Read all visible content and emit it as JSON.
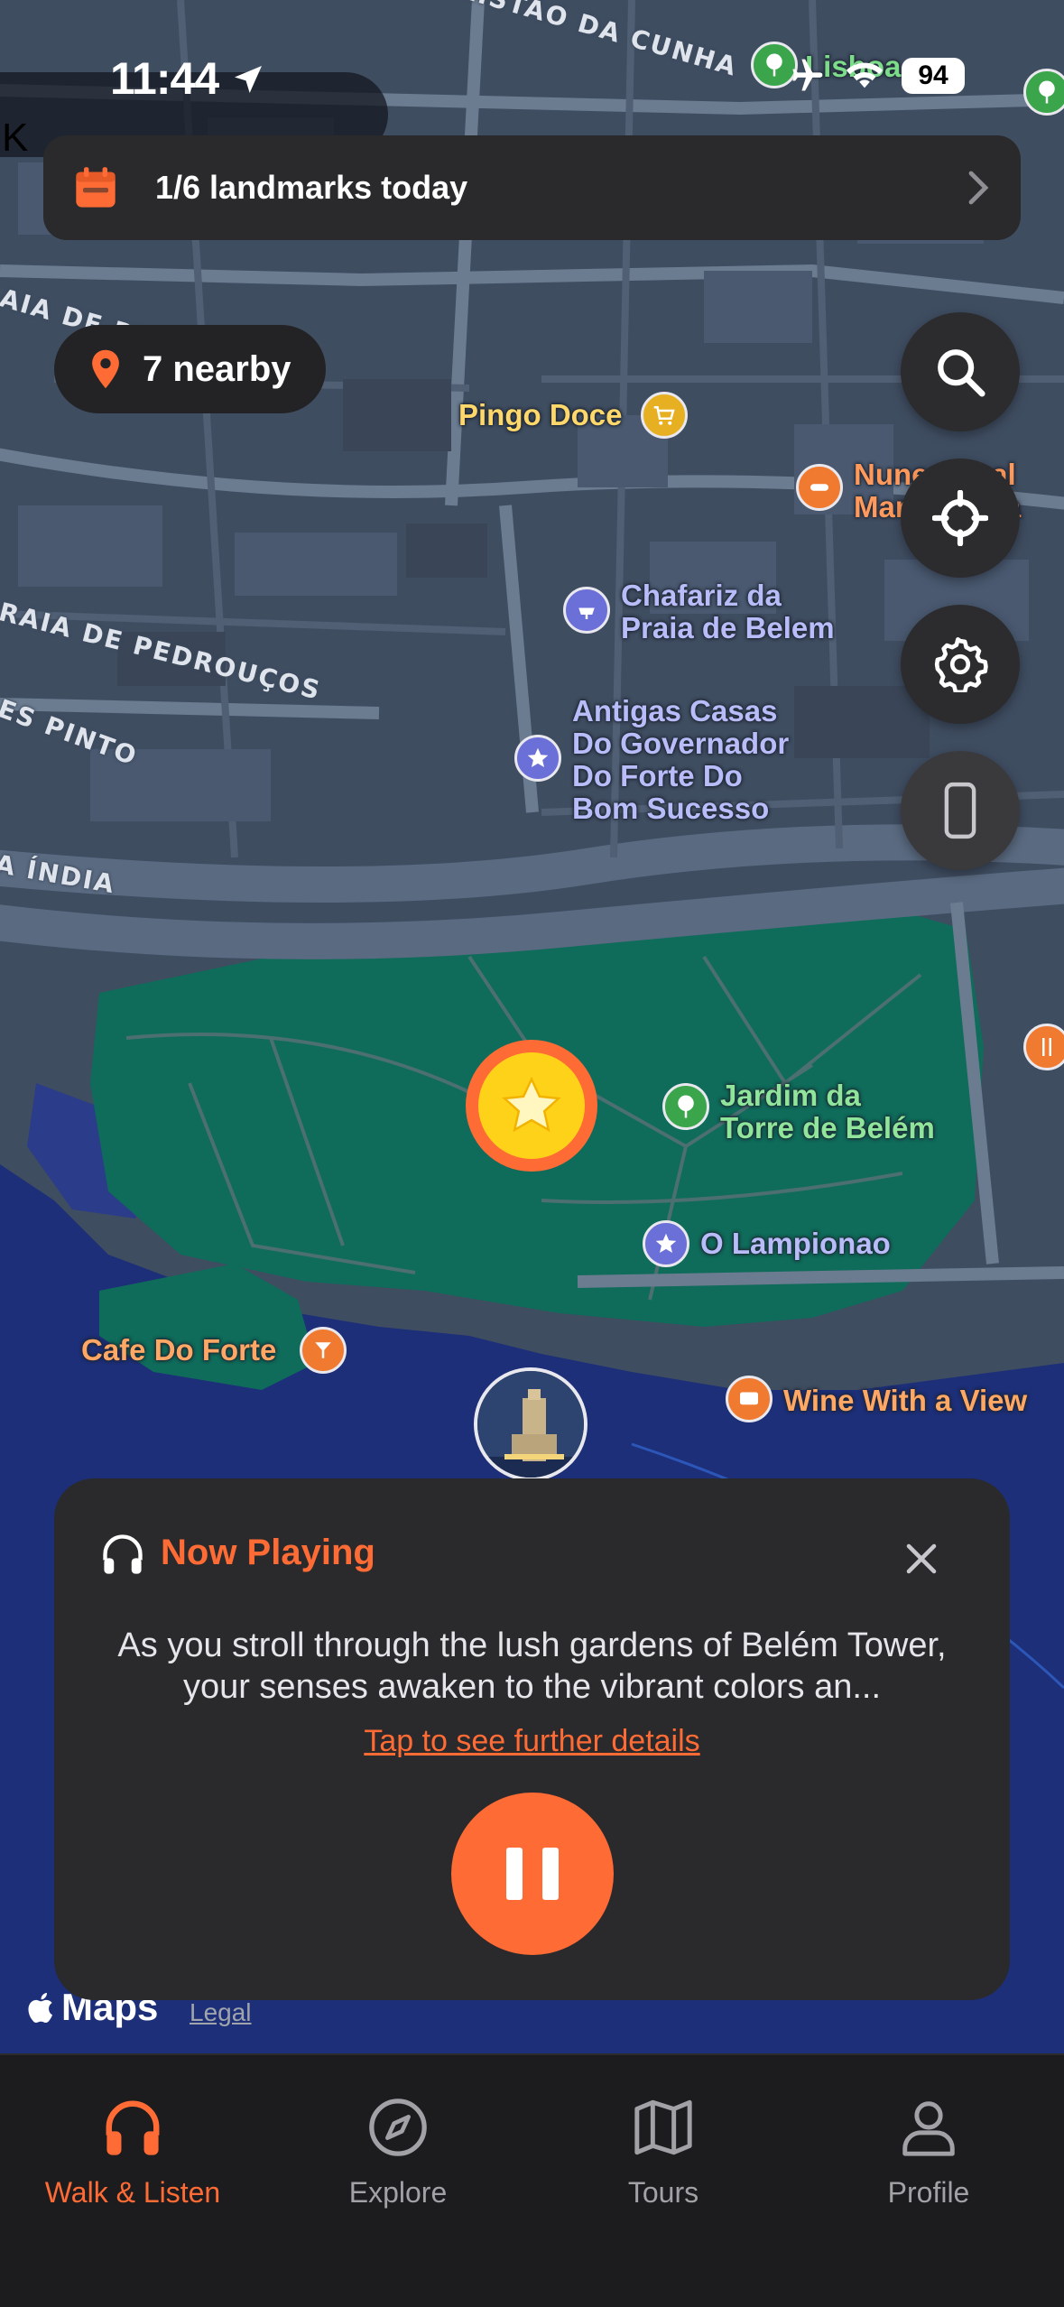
{
  "status_bar": {
    "time": "11:44",
    "battery": "94"
  },
  "map": {
    "partial_label": "K",
    "streets": [
      "RUA TRISTÃO DA CUNHA",
      "AIA DE PEDROUÇOS",
      "RAIA DE PEDROUÇOS",
      "ES PINTO",
      "A ÍNDIA"
    ],
    "pois": [
      {
        "label": "Lisboa",
        "color": "#7ddc8a"
      },
      {
        "label": "Pingo Doce",
        "color": "#ffd86b"
      },
      {
        "label": "Nunes Real\nMarisqueira",
        "color": "#ff9a5c"
      },
      {
        "label": "Chafariz da\nPraia de Belem",
        "color": "#b8bdfa"
      },
      {
        "label": "Antigas Casas\nDo Governador\nDo Forte Do\nBom Sucesso",
        "color": "#b8bdfa"
      },
      {
        "label": "Jardim da\nTorre de Belém",
        "color": "#8fe59a"
      },
      {
        "label": "O Lampionao",
        "color": "#b8bdfa"
      },
      {
        "label": "Cafe Do Forte",
        "color": "#ffa865"
      },
      {
        "label": "Wine With a View",
        "color": "#ffa865"
      }
    ],
    "attribution": {
      "brand": "Maps",
      "legal": "Legal"
    }
  },
  "banner": {
    "label": "1/6 landmarks today",
    "icon": "calendar-icon",
    "accent": "#ff6b35"
  },
  "nearby": {
    "label": "7 nearby",
    "icon": "map-pin-icon"
  },
  "controls": [
    "search-icon",
    "locate-icon",
    "gear-icon",
    "phone-icon"
  ],
  "player": {
    "title": "Now Playing",
    "description": "As you stroll through the lush gardens of Belém Tower, your senses awaken to the vibrant colors an...",
    "link": "Tap to see further details",
    "state": "playing"
  },
  "tabs": [
    {
      "label": "Walk & Listen",
      "icon": "headphones-icon",
      "active": true
    },
    {
      "label": "Explore",
      "icon": "compass-icon",
      "active": false
    },
    {
      "label": "Tours",
      "icon": "map-icon",
      "active": false
    },
    {
      "label": "Profile",
      "icon": "person-icon",
      "active": false
    }
  ],
  "colors": {
    "accent": "#ff6b35",
    "card": "#2a2a2c",
    "park": "#0f6b5a",
    "water": "#1d2f78"
  }
}
